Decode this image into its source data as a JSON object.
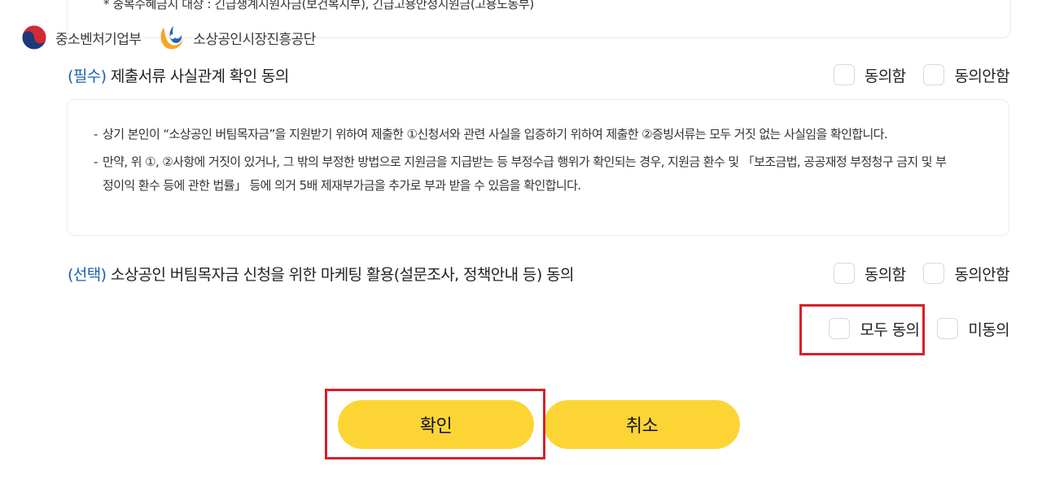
{
  "top_note": "* 중복수혜금지 대상 : 긴급생계지원자금(보건복지부), 긴급고용안정지원금(고용노동부)",
  "logos": {
    "ministry": "중소벤처기업부",
    "agency": "소상공인시장진흥공단"
  },
  "section_required": {
    "tag": "(필수)",
    "title": "제출서류 사실관계 확인 동의",
    "agree_label": "동의함",
    "disagree_label": "동의안함",
    "items": [
      "상기 본인이 “소상공인 버팀목자금”을 지원받기 위하여 제출한 ①신청서와 관련 사실을 입증하기 위하여 제출한 ②증빙서류는 모두 거짓 없는 사실임을 확인합니다.",
      "만약, 위 ①, ②사항에 거짓이 있거나, 그 밖의 부정한 방법으로 지원금을 지급받는 등 부정수급 행위가 확인되는 경우, 지원금 환수 및 「보조금법, 공공재정 부정청구 금지 및 부정이익 환수 등에 관한 법률」 등에 의거 5배 제재부가금을 추가로 부과 받을 수 있음을 확인합니다."
    ]
  },
  "section_optional": {
    "tag": "(선택)",
    "title": "소상공인 버팀목자금 신청을 위한 마케팅 활용(설문조사, 정책안내 등) 동의",
    "agree_label": "동의함",
    "disagree_label": "동의안함"
  },
  "all_options": {
    "agree_all_label": "모두 동의",
    "disagree_label": "미동의"
  },
  "buttons": {
    "confirm_label": "확인",
    "cancel_label": "취소"
  },
  "colors": {
    "accent": "#1b5fae",
    "button": "#fcd535",
    "highlight": "#d8202a"
  }
}
